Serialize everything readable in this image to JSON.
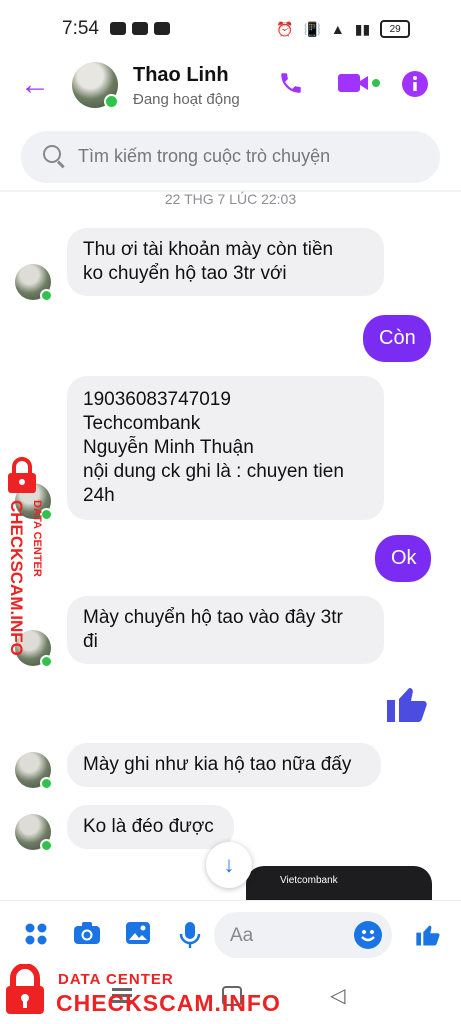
{
  "status_bar": {
    "time": "7:54",
    "battery": "29"
  },
  "header": {
    "contact_name": "Thao Linh",
    "presence": "Đang hoạt động"
  },
  "search": {
    "placeholder": "Tìm kiếm trong cuộc trò chuyện"
  },
  "timestamp": "22 THG 7 LÚC 22:03",
  "messages": [
    {
      "side": "in",
      "lines": [
        "Thu ơi tài khoản mày còn tiền",
        "ko chuyển hộ tao 3tr với"
      ]
    },
    {
      "side": "out",
      "text": "Còn"
    },
    {
      "side": "in",
      "lines": [
        "19036083747019",
        "Techcombank",
        "Nguyễn Minh Thuận",
        "nội dung ck ghi là : chuyen tien",
        "24h"
      ]
    },
    {
      "side": "out",
      "text": "Ok"
    },
    {
      "side": "in",
      "lines": [
        "Mày chuyển hộ tao vào đây 3tr",
        "đi"
      ]
    },
    {
      "side": "out",
      "icon": "thumbs-up-icon"
    },
    {
      "side": "in",
      "lines": [
        "Mày ghi như kia hộ tao nữa đấy"
      ]
    },
    {
      "side": "in",
      "lines": [
        "Ko là đéo được"
      ]
    }
  ],
  "preview": {
    "label": "Vietcombank"
  },
  "composer": {
    "placeholder": "Aa"
  },
  "watermark": {
    "top": "DATA CENTER",
    "main": "CHECKSCAM.INFO"
  },
  "colors": {
    "accent": "#7b2cf2",
    "brand_blue": "#1b74e4",
    "watermark_red": "#e22222"
  }
}
